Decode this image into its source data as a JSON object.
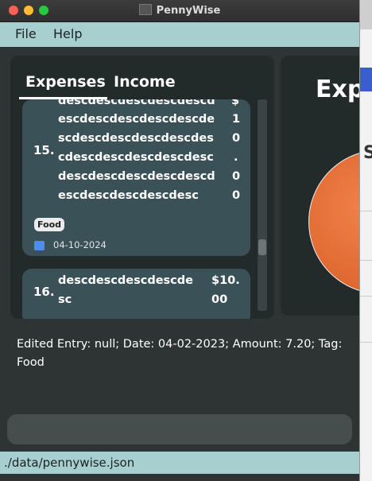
{
  "window": {
    "title": "PennyWise"
  },
  "menu": {
    "file": "File",
    "help": "Help"
  },
  "tabs": {
    "expenses": "Expenses",
    "income": "Income"
  },
  "entries": [
    {
      "index": "15.",
      "desc_lines": [
        "descdescdescdescdescd",
        "escdescdescdescdescde",
        "scdescdescdescdescdes",
        "cdescdescdescdescdesc",
        "descdescdescdescdescd",
        "escdescdescdescdesc"
      ],
      "amount_lines": [
        "$",
        "1",
        "0",
        ".",
        "0",
        "0"
      ],
      "tag": "Food",
      "date": "04-10-2024"
    },
    {
      "index": "16.",
      "desc_lines": [
        "descdescdescdescde",
        "sc"
      ],
      "amount_lines": [
        "$10.",
        "00"
      ]
    }
  ],
  "chart": {
    "title": "Exp"
  },
  "result": {
    "text": "Edited Entry: null; Date: 04-02-2023; Amount: 7.20; Tag: Food"
  },
  "command": {
    "value": ""
  },
  "status": {
    "path": "./data/pennywise.json"
  },
  "background_window": {
    "glyph": "S"
  },
  "colors": {
    "menubar": "#a8cfcf",
    "window": "#2e3434",
    "card": "#3b5158",
    "pie": "#e46b35"
  }
}
